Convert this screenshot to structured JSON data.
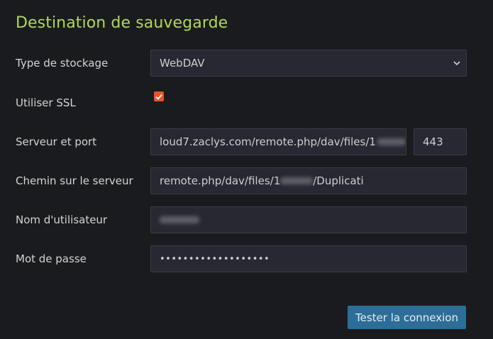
{
  "section": {
    "title": "Destination de sauvegarde"
  },
  "fields": {
    "storage_type": {
      "label": "Type de stockage",
      "value": "WebDAV"
    },
    "ssl": {
      "label": "Utiliser SSL",
      "checked": true
    },
    "server": {
      "label": "Serveur et port",
      "host_value": "loud7.zaclys.com/remote.php/dav/files/1",
      "port_value": "443"
    },
    "path": {
      "label": "Chemin sur le serveur",
      "value_prefix": "remote.php/dav/files/1",
      "value_suffix": "/Duplicati"
    },
    "username": {
      "label": "Nom d'utilisateur"
    },
    "password": {
      "label": "Mot de passe",
      "value": "•••••••••••••••••••"
    }
  },
  "actions": {
    "test_button": "Tester la connexion"
  },
  "colors": {
    "title": "#b2d85a",
    "checkbox": "#e8532a",
    "button": "#2c6e98"
  }
}
